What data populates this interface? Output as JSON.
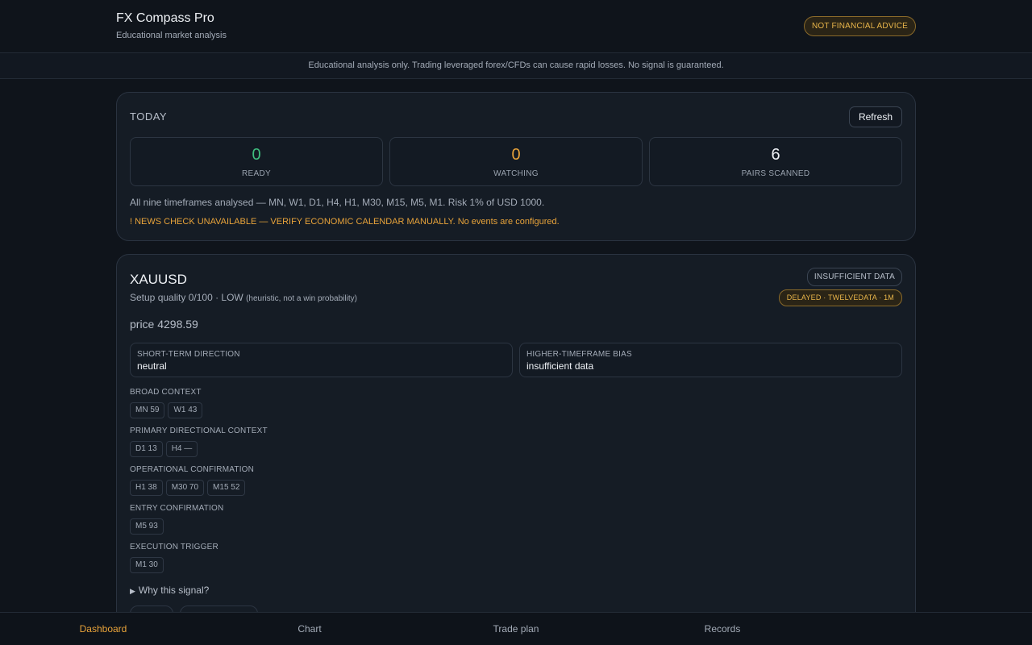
{
  "header": {
    "title": "FX Compass Pro",
    "subtitle": "Educational market analysis",
    "badge": "NOT FINANCIAL ADVICE"
  },
  "disclaimer": "Educational analysis only. Trading leveraged forex/CFDs can cause rapid losses. No signal is guaranteed.",
  "today": {
    "label": "TODAY",
    "refresh_label": "Refresh",
    "stats": [
      {
        "value": "0",
        "label": "READY"
      },
      {
        "value": "0",
        "label": "WATCHING"
      },
      {
        "value": "6",
        "label": "PAIRS SCANNED"
      }
    ],
    "summary": "All nine timeframes analysed — MN, W1, D1, H4, H1, M30, M15, M5, M1. Risk 1% of USD 1000.",
    "news_warning": "! NEWS CHECK UNAVAILABLE — VERIFY ECONOMIC CALENDAR MANUALLY. No events are configured."
  },
  "pair": {
    "symbol": "XAUUSD",
    "setup_quality": "Setup quality 0/100 · LOW",
    "setup_note": "(heuristic, not a win probability)",
    "status_badge": "INSUFFICIENT DATA",
    "feed_badge": "DELAYED · TWELVEDATA · 1M",
    "price": "price 4298.59",
    "short_term": {
      "label": "SHORT-TERM DIRECTION",
      "value": "neutral"
    },
    "htf_bias": {
      "label": "HIGHER-TIMEFRAME BIAS",
      "value": "insufficient data"
    },
    "timeframe_groups": [
      {
        "label": "BROAD CONTEXT",
        "chips": [
          "MN 59",
          "W1 43"
        ]
      },
      {
        "label": "PRIMARY DIRECTIONAL CONTEXT",
        "chips": [
          "D1 13",
          "H4 —"
        ]
      },
      {
        "label": "OPERATIONAL CONFIRMATION",
        "chips": [
          "H1 38",
          "M30 70",
          "M15 52"
        ]
      },
      {
        "label": "ENTRY CONFIRMATION",
        "chips": [
          "M5 93"
        ]
      },
      {
        "label": "EXECUTION TRIGGER",
        "chips": [
          "M1 30"
        ]
      }
    ],
    "why_label": "Why this signal?"
  },
  "nav": {
    "items": [
      "Dashboard",
      "Chart",
      "Trade plan",
      "Records"
    ],
    "active": "Dashboard"
  },
  "colors": {
    "background": "#0f141b",
    "card": "#151c25",
    "accent": "#e8a33a",
    "ready": "#3fbf7f"
  }
}
